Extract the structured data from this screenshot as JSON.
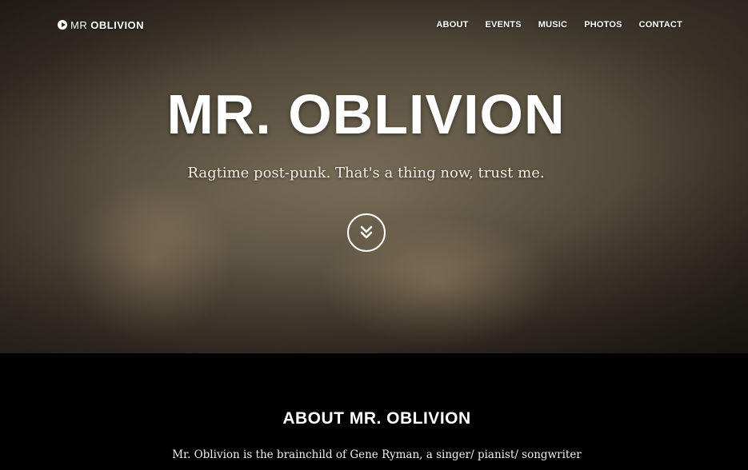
{
  "brand": {
    "prefix": "MR",
    "name": "OBLIVION",
    "icon": "play-circle-icon"
  },
  "nav": {
    "items": [
      "ABOUT",
      "EVENTS",
      "MUSIC",
      "PHOTOS",
      "CONTACT"
    ]
  },
  "hero": {
    "title": "MR. OBLIVION",
    "subtitle": "Ragtime post-punk. That's a thing now, trust me.",
    "scroll_icon": "double-chevron-down-icon"
  },
  "about": {
    "title": "ABOUT MR. OBLIVION",
    "text": "Mr. Oblivion is the brainchild of Gene Ryman, a singer/ pianist/ songwriter"
  }
}
